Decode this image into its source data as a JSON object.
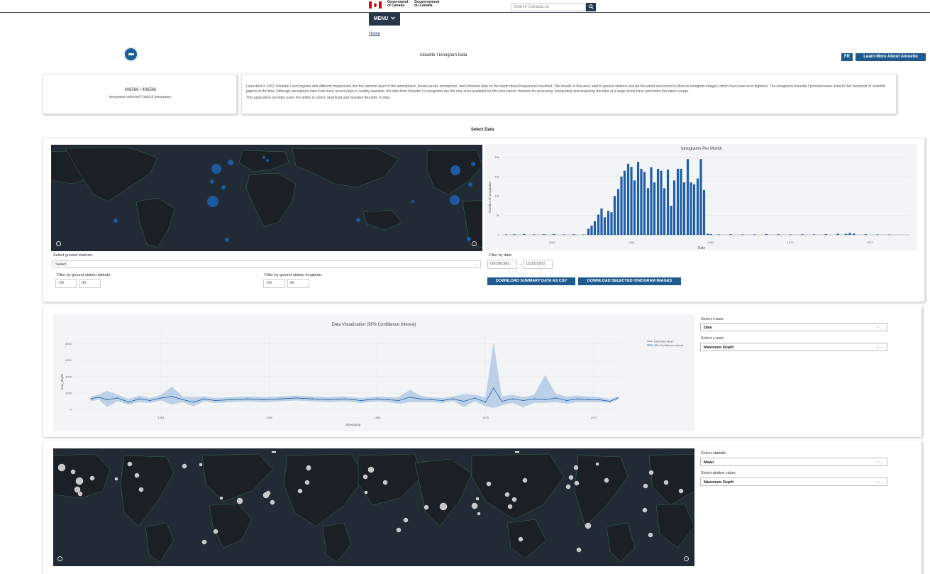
{
  "header": {
    "gov_en_line1": "Government",
    "gov_en_line2": "of Canada",
    "gov_fr_line1": "Gouvernement",
    "gov_fr_line2": "du Canada",
    "search_placeholder": "Search Canada.ca",
    "search_icon": "search-icon",
    "menu_label": "MENU",
    "menu_icon": "chevron-down-icon",
    "breadcrumb_home": "Home",
    "flag_color": "#d3080c",
    "nav_color": "#26374a"
  },
  "app": {
    "title": "Alouette I Ionogram Data",
    "lang_button": "FR",
    "learn_button": "Learn More About Alouette",
    "accent_color": "#1f5a8f",
    "count": "406566 / 406566",
    "count_label": "ionograms selected / total of ionograms.",
    "description_p1": "Launched in 1962, Alouette I sent signals with different frequencies into the topmost layer of the atmosphere, known as the ionosphere, and collected data on the depth these frequencies travelled. The results of this were sent to ground stations around the world and stored in films as ionogram images, which have now been digitized. The ionograms Alouette I provided were used to fuel hundreds of scientific papers at the time. Although ionosphere data from more recent years is readily available, the data from Alouette I's ionograms are the only ones available for this time period. Barriers for accessing, interpreting and analyzing the data at a larger scale have prevented this data's usage.",
    "description_p2": "This application provides users the ability to select, download and visualize Alouette I's data.",
    "select_heading": "Select Data"
  },
  "filters": {
    "stations_label": "Select ground stations:",
    "stations_placeholder": "Select...",
    "lat_label": "Filter by ground station latitude:",
    "lat_min": "-90",
    "lat_max": "90",
    "lon_label": "Filter by ground station longitude:",
    "lon_min": "-90",
    "lon_max": "90",
    "date_label": "Filter by date:",
    "date_start": "09/29/1962",
    "date_arrow": "→",
    "date_end": "12/31/1972",
    "download_csv": "DOWNLOAD SUMMARY DATA AS CSV",
    "download_images": "DOWNLOAD SELECTED IONOGRAM IMAGES"
  },
  "viz_controls": {
    "x_label": "Select x-axis:",
    "x_value": "Date",
    "y_label": "Select y-axis:",
    "y_value": "Maximum Depth",
    "stat_label": "Select statistic:",
    "stat_value": "Mean",
    "plotted_label": "Select plotted value:",
    "plotted_value": "Maximum Depth",
    "clear_icon": "close-icon"
  },
  "chart_data": [
    {
      "type": "bar",
      "title": "Ionograms Per Month",
      "xlabel": "Date",
      "ylabel": "Number of Ionograms",
      "x_ticks": [
        "1964",
        "1966",
        "1968",
        "1970",
        "1972"
      ],
      "y_ticks": [
        "0",
        "5k",
        "10k",
        "15k",
        "20k"
      ],
      "ylim": [
        0,
        21000
      ],
      "x_range": [
        1962.75,
        1973.0
      ],
      "bar_color": "#1f5fa8",
      "x": [
        1962.85,
        1963.05,
        1963.3,
        1963.55,
        1963.8,
        1964.05,
        1964.3,
        1964.55,
        1964.8,
        1964.92,
        1965.0,
        1965.08,
        1965.17,
        1965.25,
        1965.33,
        1965.42,
        1965.5,
        1965.58,
        1965.67,
        1965.75,
        1965.83,
        1965.92,
        1966.0,
        1966.08,
        1966.17,
        1966.25,
        1966.33,
        1966.42,
        1966.5,
        1966.58,
        1966.67,
        1966.75,
        1966.83,
        1966.92,
        1967.0,
        1967.08,
        1967.17,
        1967.25,
        1967.33,
        1967.42,
        1967.5,
        1967.58,
        1967.67,
        1967.75,
        1967.83,
        1967.92,
        1968.0,
        1968.2,
        1968.5,
        1968.8,
        1969.1,
        1969.4,
        1969.7,
        1970.0,
        1970.3,
        1970.6,
        1970.9,
        1971.2,
        1971.4,
        1971.5,
        1971.6,
        1971.9,
        1972.2,
        1972.5
      ],
      "y": [
        100,
        150,
        200,
        100,
        150,
        200,
        100,
        150,
        80,
        1600,
        2400,
        3500,
        5200,
        6800,
        4500,
        6200,
        5800,
        10000,
        11800,
        15000,
        16500,
        18300,
        17500,
        14000,
        18800,
        17000,
        16200,
        12000,
        17400,
        13500,
        17000,
        16500,
        12000,
        16800,
        7500,
        14000,
        17000,
        17000,
        13500,
        19500,
        13500,
        13000,
        14500,
        19500,
        11500,
        300,
        200,
        100,
        150,
        100,
        100,
        200,
        150,
        100,
        150,
        100,
        200,
        300,
        250,
        500,
        300,
        150,
        100,
        80
      ]
    },
    {
      "type": "line",
      "title": "Data Visualization (95% Confidence Interval)",
      "xlabel": "timestamp",
      "ylabel": "max_depth",
      "x_ticks": [
        "1964",
        "1966",
        "1968",
        "1970",
        "1972"
      ],
      "y_ticks": [
        "0",
        "2000",
        "4000",
        "6000",
        "8000"
      ],
      "ylim": [
        -500,
        9000
      ],
      "x_range": [
        1962.4,
        1972.5
      ],
      "line_color": "#1f5fa8",
      "band_color": "#aac6e2",
      "series": [
        {
          "name": "Estimated Mean"
        },
        {
          "name": "95% Confidence Interval"
        }
      ],
      "x": [
        1962.7,
        1962.85,
        1963.0,
        1963.2,
        1963.4,
        1963.6,
        1963.8,
        1964.0,
        1964.2,
        1964.4,
        1964.6,
        1964.8,
        1965.0,
        1965.3,
        1965.6,
        1965.9,
        1966.2,
        1966.5,
        1966.8,
        1967.1,
        1967.4,
        1967.7,
        1968.0,
        1968.2,
        1968.4,
        1968.6,
        1968.8,
        1969.0,
        1969.2,
        1969.4,
        1969.6,
        1969.8,
        1970.0,
        1970.15,
        1970.3,
        1970.5,
        1970.7,
        1970.9,
        1971.1,
        1971.3,
        1971.5,
        1971.7,
        1971.9,
        1972.1,
        1972.3,
        1972.45
      ],
      "mean": [
        1300,
        1500,
        1200,
        1400,
        900,
        1300,
        1100,
        1400,
        1600,
        1200,
        900,
        1300,
        1100,
        1200,
        1300,
        1200,
        1300,
        1400,
        1300,
        1200,
        1300,
        1100,
        1300,
        1200,
        1100,
        1500,
        1300,
        1200,
        1100,
        1300,
        1000,
        1400,
        900,
        2600,
        1000,
        1300,
        1100,
        1300,
        1200,
        1400,
        1100,
        1300,
        1200,
        1200,
        1000,
        1400
      ],
      "lower": [
        1000,
        1200,
        300,
        1000,
        600,
        900,
        800,
        1100,
        600,
        900,
        400,
        1000,
        800,
        900,
        1000,
        900,
        1000,
        1100,
        1000,
        900,
        1000,
        800,
        1000,
        900,
        700,
        900,
        900,
        900,
        800,
        1000,
        300,
        1000,
        400,
        200,
        500,
        800,
        300,
        800,
        800,
        900,
        700,
        900,
        900,
        900,
        800,
        1200
      ],
      "upper": [
        1600,
        1800,
        2300,
        1800,
        1300,
        1700,
        1400,
        1800,
        2800,
        1600,
        1500,
        1600,
        1400,
        1500,
        1600,
        1500,
        1600,
        1700,
        1600,
        1500,
        1600,
        1400,
        1600,
        1500,
        1500,
        2400,
        1700,
        1500,
        1400,
        1600,
        1900,
        1800,
        1500,
        8200,
        1600,
        1800,
        1500,
        1800,
        4200,
        1900,
        1600,
        1700,
        1600,
        1500,
        1300,
        1600
      ]
    }
  ]
}
